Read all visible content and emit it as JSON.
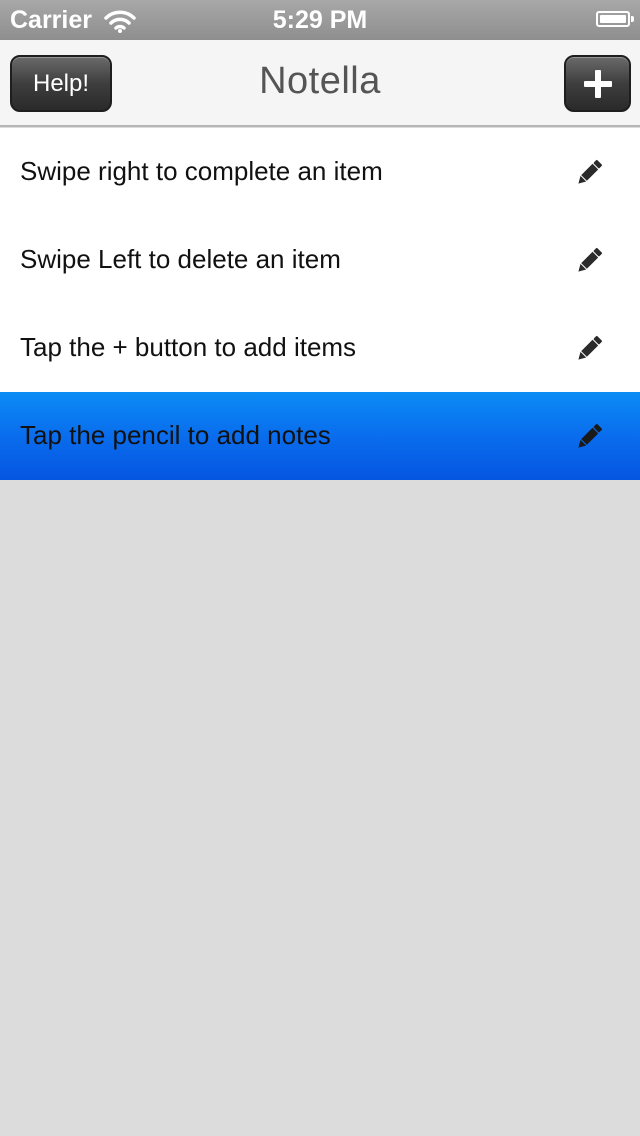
{
  "status_bar": {
    "carrier": "Carrier",
    "time": "5:29 PM",
    "wifi_icon": "wifi-icon",
    "battery_icon": "battery-icon"
  },
  "nav_bar": {
    "title": "Notella",
    "help_label": "Help!",
    "add_icon": "plus-icon"
  },
  "list": {
    "items": [
      {
        "label": "Swipe right to complete an item",
        "icon": "pencil-icon",
        "selected": false
      },
      {
        "label": "Swipe Left to delete an item",
        "icon": "pencil-icon",
        "selected": false
      },
      {
        "label": "Tap the + button to add items",
        "icon": "pencil-icon",
        "selected": false
      },
      {
        "label": "Tap the pencil to add notes",
        "icon": "pencil-icon",
        "selected": true
      }
    ]
  },
  "colors": {
    "status_bar": "#999999",
    "nav_bar": "#f5f5f5",
    "selected_row": "#0a6ded",
    "background": "#dcdcdc",
    "button_dark": "#3e3e3e"
  }
}
